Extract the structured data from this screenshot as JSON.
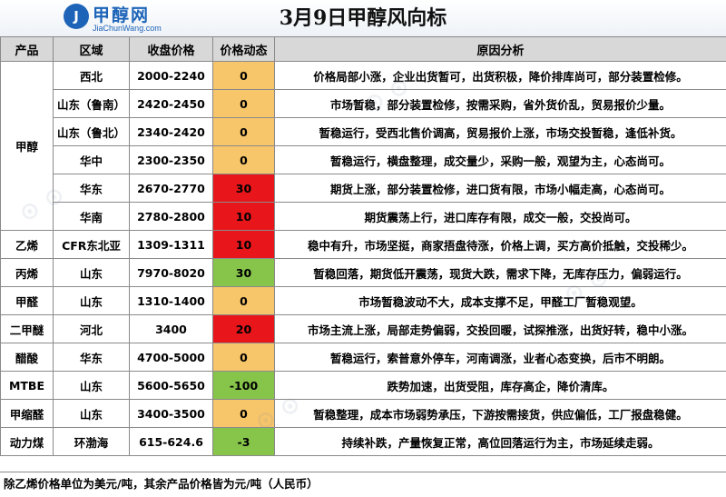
{
  "header": {
    "logo_cn": "甲醇网",
    "logo_en": "JiaChunWang.com",
    "title": "3月9日甲醇风向标"
  },
  "columns": [
    "产品",
    "区域",
    "收盘价格",
    "价格动态",
    "原因分析"
  ],
  "rows": [
    {
      "product": "甲醇",
      "region": "西北",
      "price": "2000-2240",
      "change": "0",
      "trend": "flat",
      "reason": "价格局部小涨，企业出货暂可，出货积极，降价排库尚可，部分装置检修。"
    },
    {
      "product": "",
      "region": "山东（鲁南）",
      "price": "2420-2450",
      "change": "0",
      "trend": "flat",
      "reason": "市场暂稳，部分装置检修，按需采购，省外货价乱，贸易报价少量。"
    },
    {
      "product": "",
      "region": "山东（鲁北）",
      "price": "2340-2420",
      "change": "0",
      "trend": "flat",
      "reason": "暂稳运行，受西北售价调高，贸易报价上涨，市场交投暂稳，逢低补货。"
    },
    {
      "product": "",
      "region": "华中",
      "price": "2300-2350",
      "change": "0",
      "trend": "flat",
      "reason": "暂稳运行，横盘整理，成交量少，采购一般，观望为主，心态尚可。"
    },
    {
      "product": "",
      "region": "华东",
      "price": "2670-2770",
      "change": "30",
      "trend": "up",
      "reason": "期货上涨，部分装置检修，进口货有限，市场小幅走高，心态尚可。"
    },
    {
      "product": "",
      "region": "华南",
      "price": "2780-2800",
      "change": "10",
      "trend": "up",
      "reason": "期货震荡上行，进口库存有限，成交一般，交投尚可。"
    },
    {
      "product": "乙烯",
      "region": "CFR东北亚",
      "price": "1309-1311",
      "change": "10",
      "trend": "up",
      "reason": "稳中有升，市场坚挺，商家捂盘待涨，价格上调，买方高价抵触，交投稀少。"
    },
    {
      "product": "丙烯",
      "region": "山东",
      "price": "7970-8020",
      "change": "30",
      "trend": "down",
      "reason": "暂稳回落，期货低开震荡，现货大跌，需求下降，无库存压力，偏弱运行。"
    },
    {
      "product": "甲醛",
      "region": "山东",
      "price": "1310-1400",
      "change": "0",
      "trend": "flat",
      "reason": "市场暂稳波动不大，成本支撑不足，甲醛工厂暂稳观望。"
    },
    {
      "product": "二甲醚",
      "region": "河北",
      "price": "3400",
      "change": "20",
      "trend": "up",
      "reason": "市场主流上涨，局部走势偏弱，交投回暖，试探推涨，出货好转，稳中小涨。"
    },
    {
      "product": "醋酸",
      "region": "华东",
      "price": "4700-5000",
      "change": "0",
      "trend": "flat",
      "reason": "暂稳运行，索普意外停车，河南调涨，业者心态变换，后市不明朗。"
    },
    {
      "product": "MTBE",
      "region": "山东",
      "price": "5600-5650",
      "change": "-100",
      "trend": "down",
      "reason": "跌势加速，出货受阻，库存高企，降价清库。"
    },
    {
      "product": "甲缩醛",
      "region": "山东",
      "price": "3400-3500",
      "change": "0",
      "trend": "flat",
      "reason": "暂稳整理，成本市场弱势承压，下游按需接货，供应偏低，工厂报盘稳健。"
    },
    {
      "product": "动力煤",
      "region": "环渤海",
      "price": "615-624.6",
      "change": "-3",
      "trend": "down",
      "reason": "持续补跌，产量恢复正常，高位回落运行为主，市场延续走弱。"
    }
  ],
  "footer": "除乙烯价格单位为美元/吨，其余产品价格皆为元/吨（人民币）",
  "colors": {
    "flat": "#f7c56a",
    "up": "#e8161b",
    "down": "#86c44a"
  }
}
